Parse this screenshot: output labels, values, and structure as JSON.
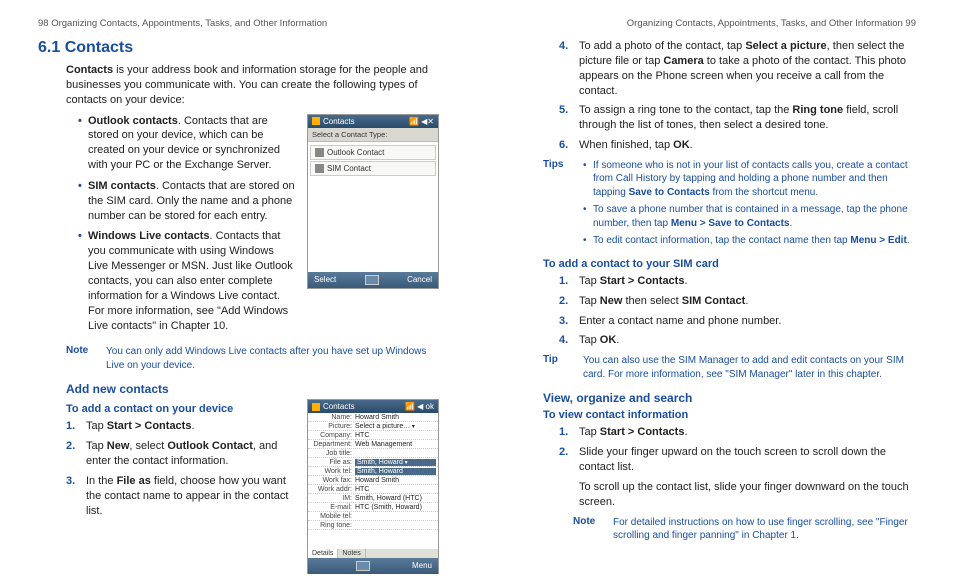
{
  "headers": {
    "left": "98  Organizing Contacts, Appointments, Tasks, and Other Information",
    "right": "Organizing Contacts, Appointments, Tasks, and Other Information  99"
  },
  "left": {
    "h1": "6.1  Contacts",
    "intro_a": "Contacts",
    "intro_b": " is your address book and information storage for the people and businesses you communicate with. You can create the following types of contacts on your device:",
    "bullets": [
      {
        "b": "Outlook contacts",
        "t": ". Contacts that are stored on your device, which can be created on your device or synchronized with your PC or the Exchange Server."
      },
      {
        "b": "SIM contacts",
        "t": ". Contacts that are stored on the SIM card. Only the name and a phone number can be stored for each entry."
      },
      {
        "b": "Windows Live contacts",
        "t": ". Contacts that you communicate with using Windows Live Messenger or MSN. Just like Outlook contacts, you can also enter complete information for a Windows Live contact. For more information, see \"Add Windows Live contacts\" in Chapter 10."
      }
    ],
    "note1_label": "Note",
    "note1_body": "You can only add Windows Live contacts after you have set up Windows Live on your device.",
    "h2": "Add new contacts",
    "h3a": "To add a contact on your device",
    "steps_a": [
      {
        "pre": "Tap ",
        "b1": "Start > Contacts",
        "post": "."
      },
      {
        "pre": "Tap ",
        "b1": "New",
        "mid": ", select ",
        "b2": "Outlook Contact",
        "post": ", and enter the contact information."
      },
      {
        "pre": "In the ",
        "b1": "File as",
        "post": " field, choose how you want the contact name to appear in the contact list."
      }
    ],
    "ss1": {
      "title": "Contacts",
      "sub": "Select a Contact Type:",
      "items": [
        "Outlook Contact",
        "SIM Contact"
      ],
      "left_btn": "Select",
      "right_btn": "Cancel"
    },
    "ss2": {
      "title": "Contacts",
      "rows": [
        {
          "lbl": "Name:",
          "val": "Howard Smith"
        },
        {
          "lbl": "Picture:",
          "val": "Select a picture…",
          "dd": true
        },
        {
          "lbl": "Company:",
          "val": "HTC"
        },
        {
          "lbl": "Department:",
          "val": "Web Management"
        },
        {
          "lbl": "Job title:",
          "val": ""
        },
        {
          "lbl": "File as:",
          "val": "Smith, Howard",
          "sel": true,
          "dd": true
        },
        {
          "lbl": "Work tel:",
          "val": "Smith, Howard",
          "sel": true
        },
        {
          "lbl": "Work fax:",
          "val": "Howard Smith"
        },
        {
          "lbl": "Work addr:",
          "val": "HTC"
        },
        {
          "lbl": "IM:",
          "val": "Smith, Howard (HTC)"
        },
        {
          "lbl": "E-mail:",
          "val": "HTC (Smith, Howard)"
        },
        {
          "lbl": "Mobile tel:",
          "val": ""
        },
        {
          "lbl": "Ring tone:",
          "val": ""
        }
      ],
      "tabs": [
        "Details",
        "Notes"
      ],
      "right_btn": "Menu"
    }
  },
  "right": {
    "steps_cont": [
      {
        "pre": "To add a photo of the contact, tap ",
        "b1": "Select a picture",
        "mid": ", then select the picture file or tap ",
        "b2": "Camera",
        "post": " to take a photo of the contact. This photo appears on the Phone screen when you receive a call from the contact."
      },
      {
        "pre": "To assign a ring tone to the contact, tap the ",
        "b1": "Ring tone",
        "post": " field, scroll through the list of tones, then select a desired tone."
      },
      {
        "pre": "When finished, tap ",
        "b1": "OK",
        "post": "."
      }
    ],
    "tips_label": "Tips",
    "tips": [
      {
        "pre": "If someone who is not in your list of contacts calls you, create a contact from Call History by tapping and holding a phone number and then tapping ",
        "b1": "Save to Contacts",
        "post": " from the shortcut menu."
      },
      {
        "pre": "To save a phone number that is contained in a message, tap the phone number, then tap ",
        "b1": "Menu > Save to Contacts",
        "post": "."
      },
      {
        "pre": "To edit contact information, tap the contact name then tap ",
        "b1": "Menu > ",
        "b2": "Edit",
        "post": "."
      }
    ],
    "h3b": "To add a contact to your SIM card",
    "steps_b": [
      {
        "pre": "Tap ",
        "b1": "Start > Contacts",
        "post": "."
      },
      {
        "pre": "Tap ",
        "b1": "New",
        "mid": " then select ",
        "b2": "SIM Contact",
        "post": "."
      },
      {
        "pre": "Enter a contact name and phone number.",
        "plain": true
      },
      {
        "pre": "Tap ",
        "b1": "OK",
        "post": "."
      }
    ],
    "tip2_label": "Tip",
    "tip2_body": "You can also use the SIM Manager to add and edit contacts on your SIM card. For more information, see \"SIM Manager\" later in this chapter.",
    "h2b": "View, organize and search",
    "h3c": "To view contact information",
    "steps_c": [
      {
        "pre": "Tap ",
        "b1": "Start > Contacts",
        "post": "."
      },
      {
        "pre": "Slide your finger upward on the touch screen to scroll down the contact list.",
        "plain": true
      }
    ],
    "para_c": "To scroll up the contact list, slide your finger downward on the touch screen.",
    "note2_label": "Note",
    "note2_body": "For detailed instructions on how to use finger scrolling, see \"Finger scrolling and finger panning\" in Chapter 1."
  }
}
